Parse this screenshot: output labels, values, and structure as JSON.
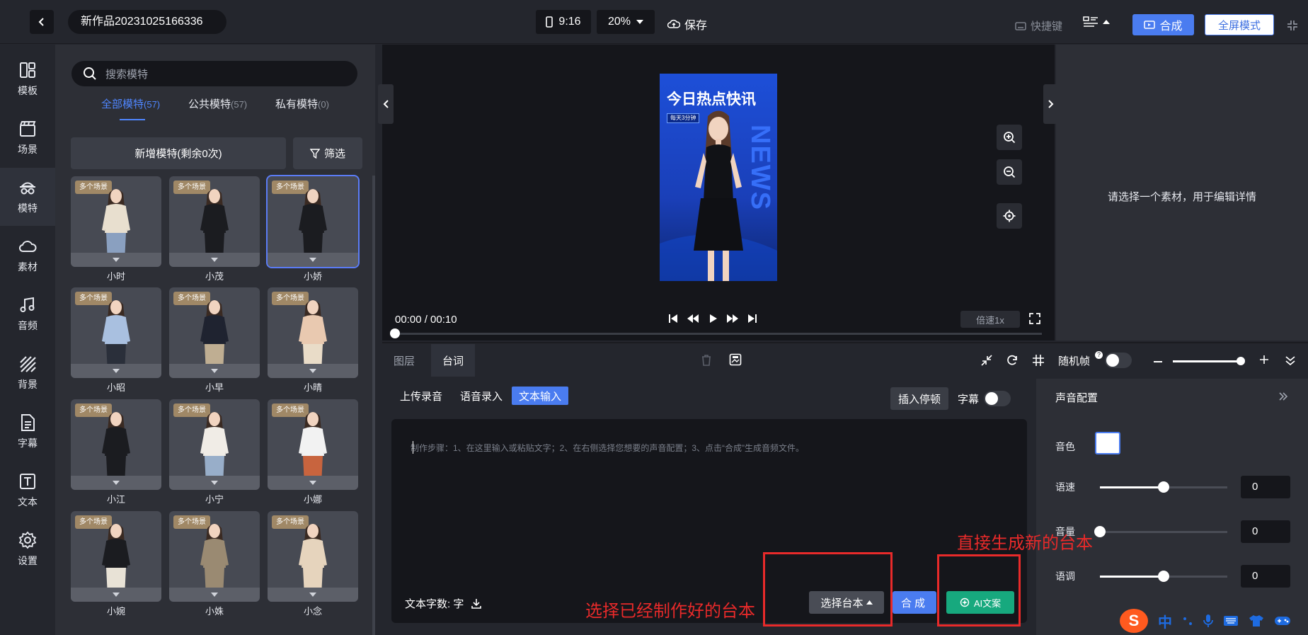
{
  "header": {
    "project_title": "新作品20231025166336",
    "ratio": "9:16",
    "zoom": "20%",
    "save_label": "保存",
    "shortcut_label": "快捷键",
    "compose_label": "合成",
    "fullscreen_label": "全屏模式"
  },
  "sidebar": {
    "items": [
      {
        "label": "模板",
        "icon": "template-icon"
      },
      {
        "label": "场景",
        "icon": "clapper-icon"
      },
      {
        "label": "模特",
        "icon": "model-icon"
      },
      {
        "label": "素材",
        "icon": "cloud-icon"
      },
      {
        "label": "音频",
        "icon": "music-icon"
      },
      {
        "label": "背景",
        "icon": "stripes-icon"
      },
      {
        "label": "字幕",
        "icon": "doc-icon"
      },
      {
        "label": "文本",
        "icon": "text-icon"
      },
      {
        "label": "设置",
        "icon": "gear-icon"
      }
    ],
    "active_index": 2
  },
  "model_panel": {
    "search_placeholder": "搜索模特",
    "tabs": [
      {
        "label": "全部模特",
        "count": "(57)"
      },
      {
        "label": "公共模特",
        "count": "(57)"
      },
      {
        "label": "私有模特",
        "count": "(0)"
      }
    ],
    "add_button": "新增模特(剩余0次)",
    "filter_button": "筛选",
    "badge_text": "多个场景",
    "models": [
      {
        "name": "小时",
        "outfit": "#e8dfcf",
        "pants": "#8aa0c0"
      },
      {
        "name": "小茂",
        "outfit": "#1b1c20",
        "pants": "#1b1c20"
      },
      {
        "name": "小娇",
        "outfit": "#1b1c20",
        "pants": "#1b1c20"
      },
      {
        "name": "小昭",
        "outfit": "#a9c0e0",
        "pants": "#2a2f3a"
      },
      {
        "name": "小早",
        "outfit": "#1f2330",
        "pants": "#bfae92"
      },
      {
        "name": "小晴",
        "outfit": "#e9c9b0",
        "pants": "#e9dcc8"
      },
      {
        "name": "小江",
        "outfit": "#1b1c20",
        "pants": "#1b1c20"
      },
      {
        "name": "小宁",
        "outfit": "#f0ece6",
        "pants": "#98aec9"
      },
      {
        "name": "小娜",
        "outfit": "#f2f2f2",
        "pants": "#c8643e"
      },
      {
        "name": "小婉",
        "outfit": "#1b1c20",
        "pants": "#e8e2d6"
      },
      {
        "name": "小姝",
        "outfit": "#9a8a72",
        "pants": "#9a8a72"
      },
      {
        "name": "小念",
        "outfit": "#e6d4bd",
        "pants": "#e6d4bd"
      }
    ]
  },
  "preview": {
    "video_title": "今日热点快讯",
    "video_subtitle": "每天3分钟",
    "video_watermark": "NEWS",
    "time": "00:00 / 00:10",
    "speed": "倍速1x",
    "progress": 0
  },
  "detail_panel": {
    "hint": "请选择一个素材，用于编辑详情"
  },
  "editor": {
    "tabs": [
      "图层",
      "台词"
    ],
    "active_tab": 1,
    "random_frame_label": "随机帧",
    "help_mark": "?",
    "subtabs": [
      "上传录音",
      "语音录入",
      "文本输入"
    ],
    "active_subtab": 2,
    "insert_pause": "插入停顿",
    "subtitle_label": "字幕",
    "placeholder": "制作步骤：1、在这里输入或粘贴文字；2、在右侧选择您想要的声音配置；3、点击“合成”生成音频文件。",
    "word_count": "文本字数: 字",
    "pick_script": "选择台本",
    "synth": "合成",
    "ai_copy": "AI文案"
  },
  "annotations": {
    "left": "选择已经制作好的台本",
    "right": "直接生成新的台本"
  },
  "voice_config": {
    "title": "声音配置",
    "timbre_label": "音色",
    "rows": [
      {
        "label": "语速",
        "value": "0",
        "level": 0.5
      },
      {
        "label": "音量",
        "value": "0",
        "level": 0.0
      },
      {
        "label": "语调",
        "value": "0",
        "level": 0.5
      }
    ]
  },
  "ime": {
    "chinese": "中"
  },
  "colors": {
    "accent": "#4a7cf0",
    "annotation": "#e82a2a",
    "ai_button": "#17a97e"
  }
}
